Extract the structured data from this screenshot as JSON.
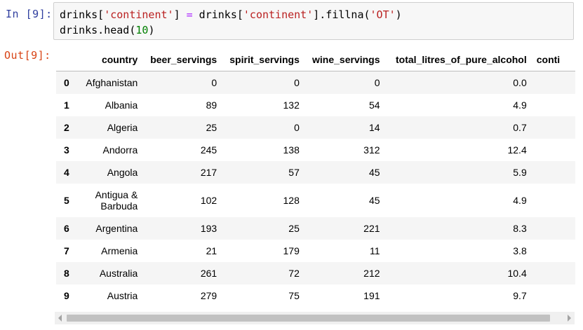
{
  "cell": {
    "in_prompt": "In [9]:",
    "out_prompt": "Out[9]:",
    "code": {
      "line1_a": "drinks[",
      "line1_str1": "'continent'",
      "line1_b": "] ",
      "line1_op": "=",
      "line1_c": " drinks[",
      "line1_str2": "'continent'",
      "line1_d": "].fillna(",
      "line1_str3": "'OT'",
      "line1_e": ")",
      "line2_a": "drinks.head(",
      "line2_num": "10",
      "line2_b": ")"
    }
  },
  "table": {
    "columns": [
      "",
      "country",
      "beer_servings",
      "spirit_servings",
      "wine_servings",
      "total_litres_of_pure_alcohol",
      "conti"
    ],
    "rows": [
      {
        "index": "0",
        "country": "Afghanistan",
        "beer": "0",
        "spirit": "0",
        "wine": "0",
        "alcohol": "0.0"
      },
      {
        "index": "1",
        "country": "Albania",
        "beer": "89",
        "spirit": "132",
        "wine": "54",
        "alcohol": "4.9"
      },
      {
        "index": "2",
        "country": "Algeria",
        "beer": "25",
        "spirit": "0",
        "wine": "14",
        "alcohol": "0.7"
      },
      {
        "index": "3",
        "country": "Andorra",
        "beer": "245",
        "spirit": "138",
        "wine": "312",
        "alcohol": "12.4"
      },
      {
        "index": "4",
        "country": "Angola",
        "beer": "217",
        "spirit": "57",
        "wine": "45",
        "alcohol": "5.9"
      },
      {
        "index": "5",
        "country": "Antigua & Barbuda",
        "beer": "102",
        "spirit": "128",
        "wine": "45",
        "alcohol": "4.9"
      },
      {
        "index": "6",
        "country": "Argentina",
        "beer": "193",
        "spirit": "25",
        "wine": "221",
        "alcohol": "8.3"
      },
      {
        "index": "7",
        "country": "Armenia",
        "beer": "21",
        "spirit": "179",
        "wine": "11",
        "alcohol": "3.8"
      },
      {
        "index": "8",
        "country": "Australia",
        "beer": "261",
        "spirit": "72",
        "wine": "212",
        "alcohol": "10.4"
      },
      {
        "index": "9",
        "country": "Austria",
        "beer": "279",
        "spirit": "75",
        "wine": "191",
        "alcohol": "9.7"
      }
    ]
  },
  "scrollbar": {
    "left_icon": "arrow-left-icon",
    "right_icon": "arrow-right-icon"
  }
}
